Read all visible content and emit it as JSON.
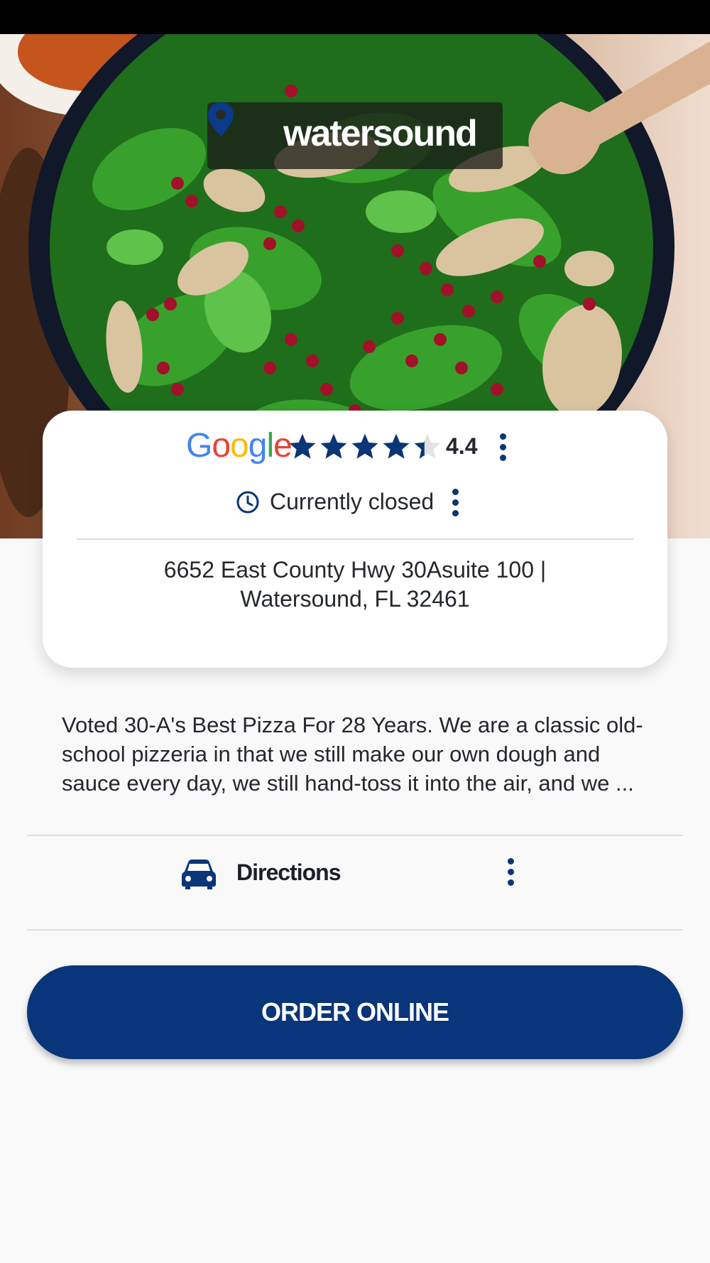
{
  "location": {
    "name": "watersound"
  },
  "rating": {
    "provider": "Google",
    "value": "4.4",
    "stars": 4.4,
    "star_color": "#0a3576"
  },
  "hours": {
    "status": "Currently closed"
  },
  "address": {
    "line1": "6652 East County Hwy 30Asuite 100 |",
    "line2": "Watersound, FL  32461"
  },
  "description": "Voted 30-A's Best Pizza For 28 Years. We are a classic old-school pizzeria in that we still make our own dough and sauce every day, we still hand-toss it into the air, and we ...",
  "directions": {
    "label": "Directions"
  },
  "order": {
    "label": "ORDER ONLINE",
    "color": "#09357a"
  },
  "icons": {
    "location": "map-pin-icon",
    "hours": "clock-icon",
    "directions": "car-icon",
    "more": "more-vertical-icon"
  }
}
